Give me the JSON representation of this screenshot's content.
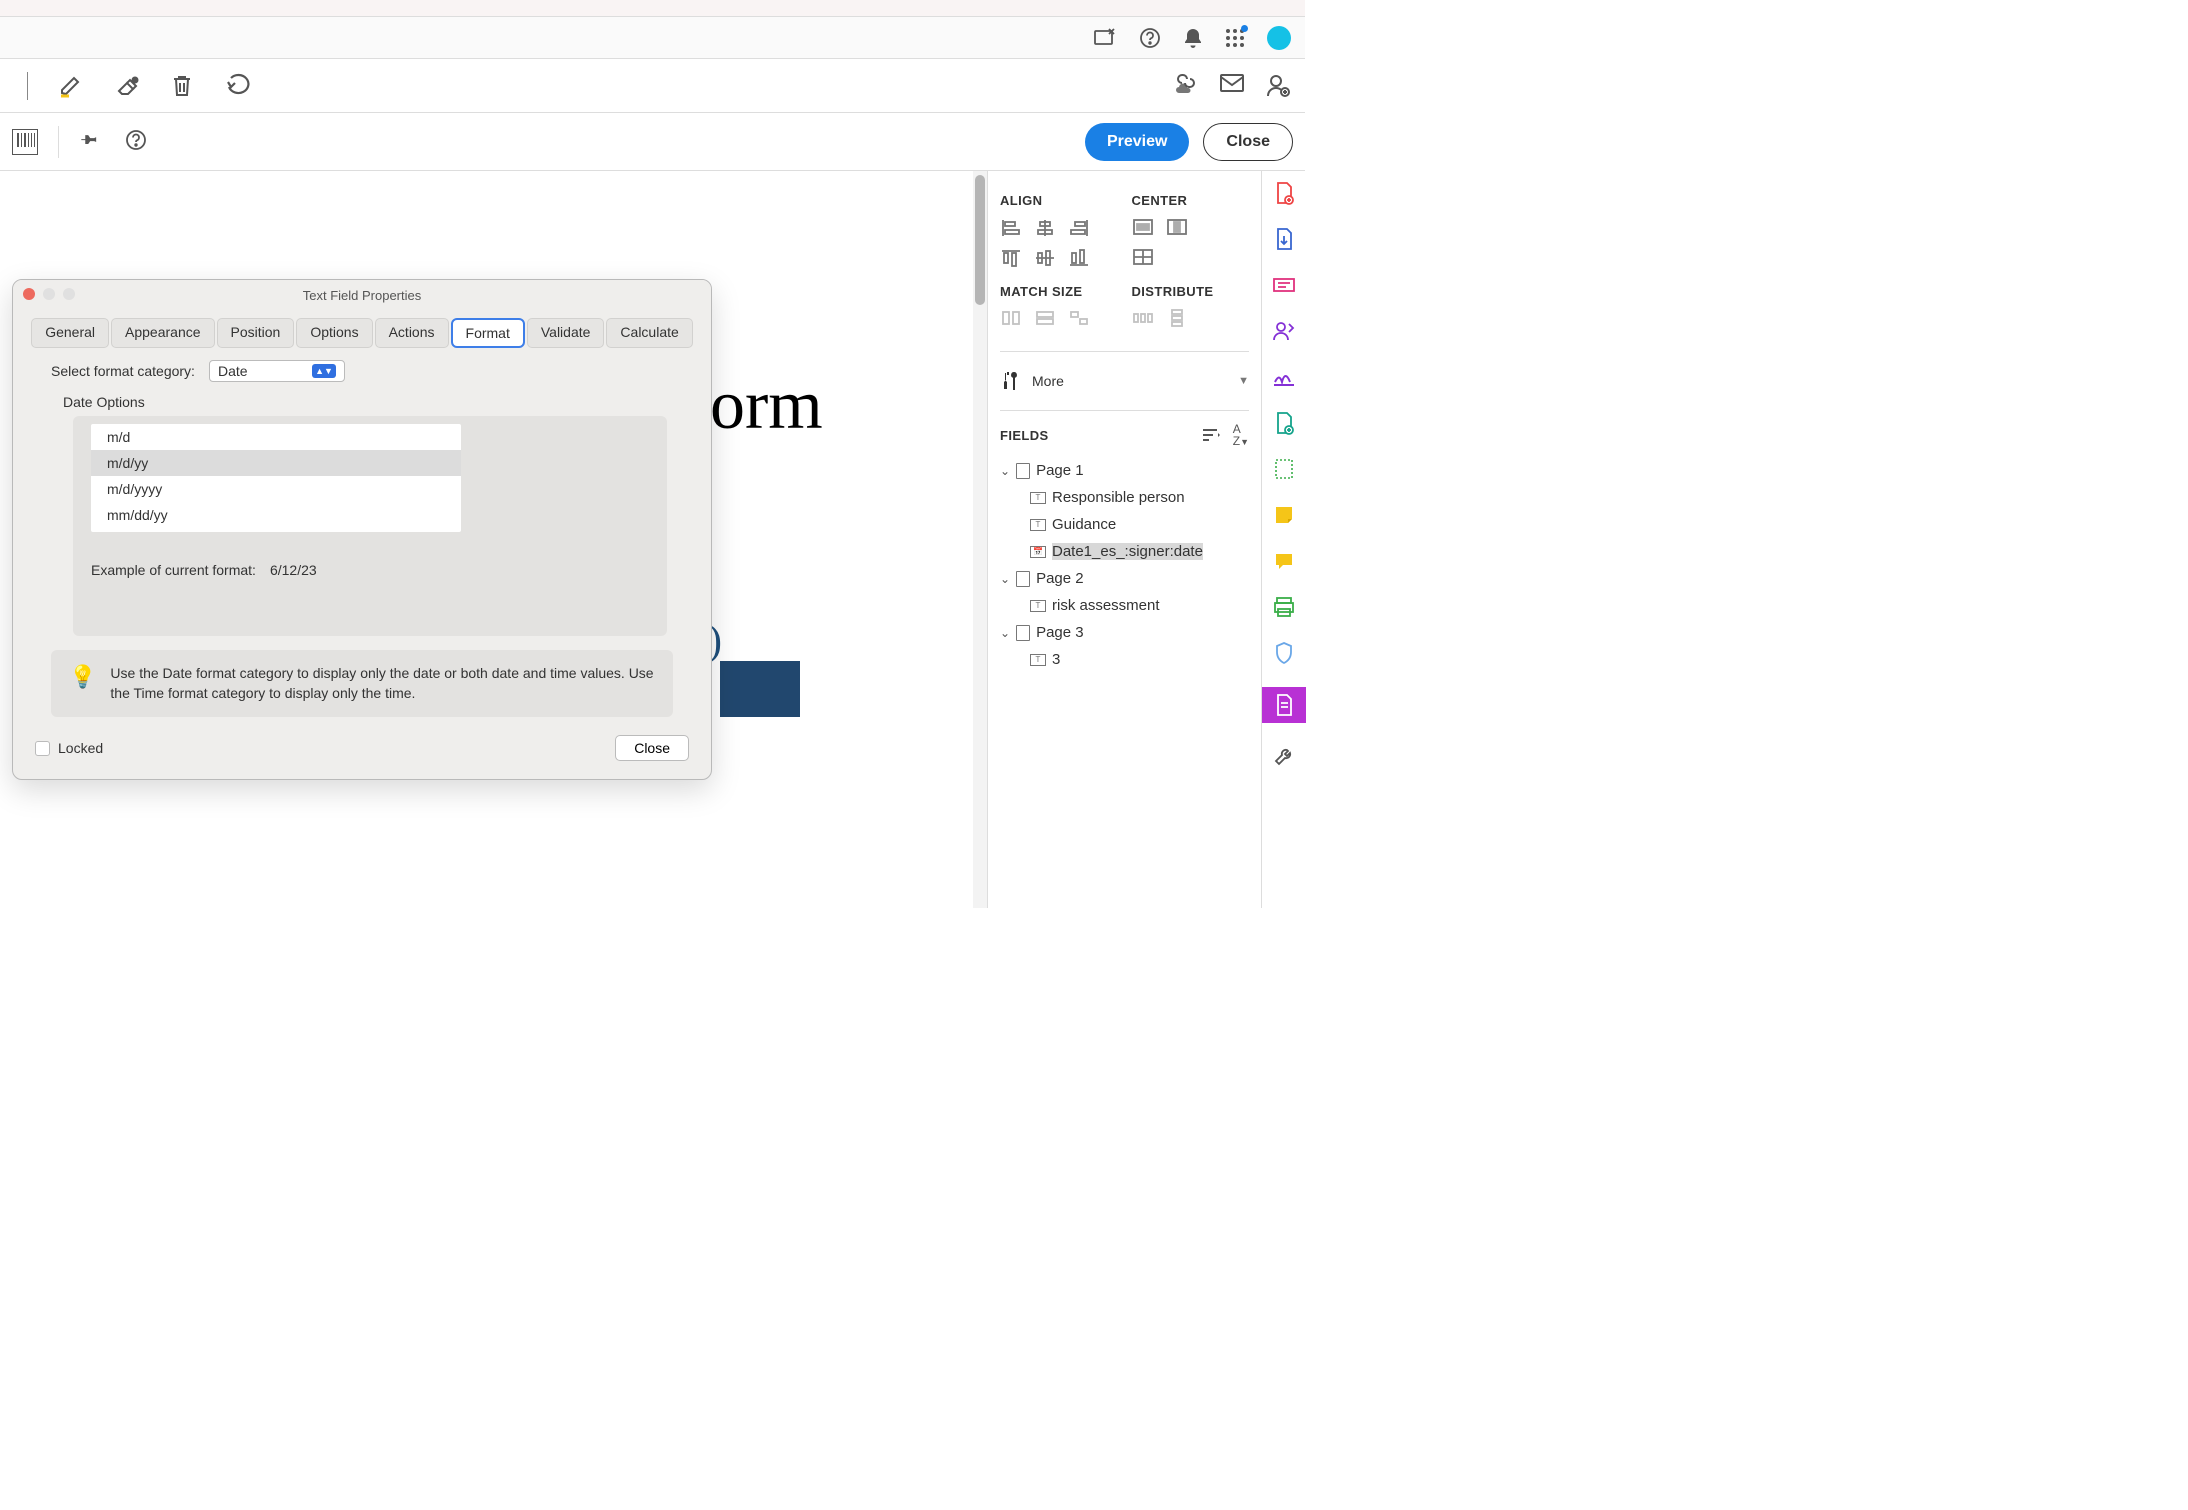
{
  "header": {
    "preview_button": "Preview",
    "close_button": "Close"
  },
  "doc_background": {
    "big_text": "orm",
    "blue_text": "ls)"
  },
  "panel": {
    "align_title": "ALIGN",
    "center_title": "CENTER",
    "match_title": "MATCH SIZE",
    "distribute_title": "DISTRIBUTE",
    "more_label": "More",
    "fields_title": "FIELDS",
    "tree": {
      "page1": "Page 1",
      "p1_f1": "Responsible person",
      "p1_f2": "Guidance",
      "p1_f3": "Date1_es_:signer:date",
      "page2": "Page 2",
      "p2_f1": "risk assessment",
      "page3": "Page 3",
      "p3_f1": "3"
    }
  },
  "dialog": {
    "title": "Text Field Properties",
    "tabs": {
      "general": "General",
      "appearance": "Appearance",
      "position": "Position",
      "options": "Options",
      "actions": "Actions",
      "format": "Format",
      "validate": "Validate",
      "calculate": "Calculate"
    },
    "select_label": "Select format category:",
    "select_value": "Date",
    "section_title": "Date Options",
    "list": {
      "i0": "m/d",
      "i1": "m/d/yy",
      "i2": "m/d/yyyy",
      "i3": "mm/dd/yy"
    },
    "example_label": "Example of current format:",
    "example_value": "6/12/23",
    "hint": "Use the Date format category to display only the date or both date and time values. Use the Time format category to display only the time.",
    "locked_label": "Locked",
    "close_button": "Close"
  }
}
